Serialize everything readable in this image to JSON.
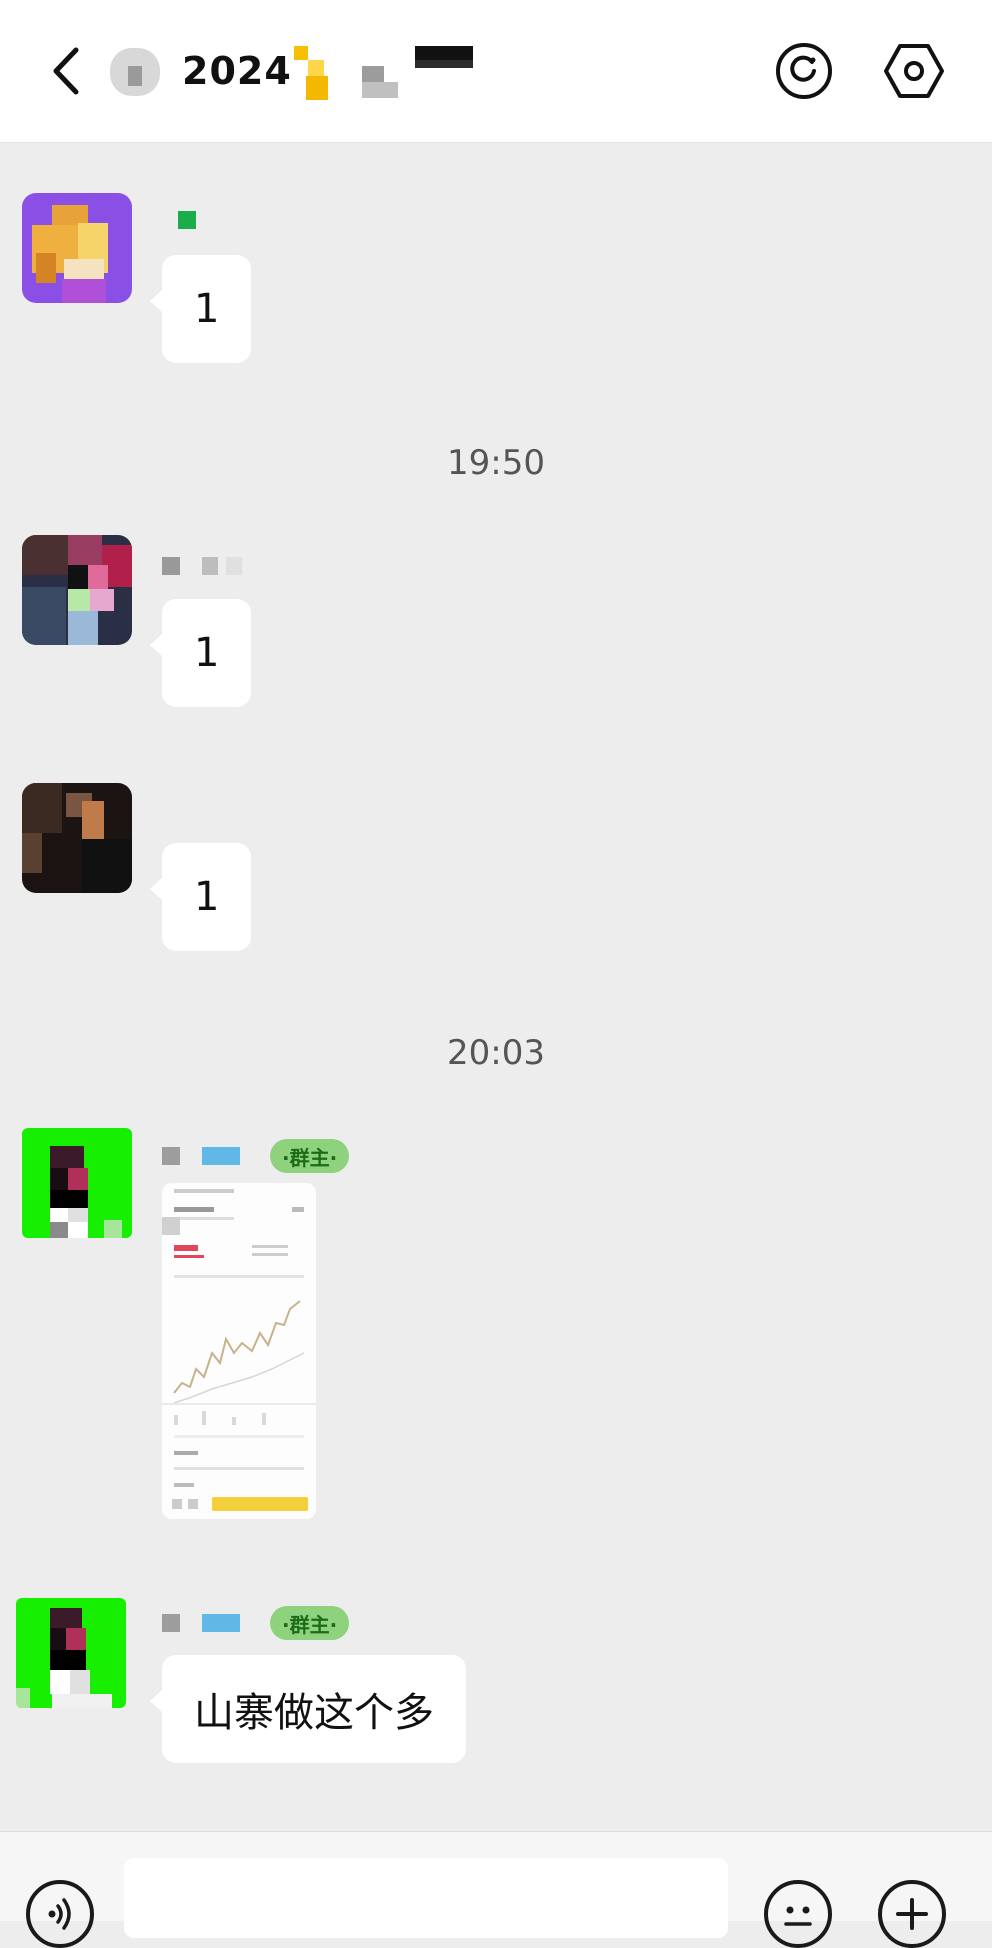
{
  "header": {
    "title": "2024",
    "back_icon": "chevron-left-icon",
    "chat_info_icon": "mini-program-icon",
    "settings_icon": "hexagon-settings-icon"
  },
  "messages": [
    {
      "type": "text",
      "text": "1"
    },
    {
      "type": "timestamp",
      "text": "19:50"
    },
    {
      "type": "text",
      "text": "1"
    },
    {
      "type": "text",
      "text": "1"
    },
    {
      "type": "timestamp",
      "text": "20:03"
    },
    {
      "type": "image",
      "role_badge": "·群主·",
      "thumbnail_icon": "trading-chart-screenshot"
    },
    {
      "type": "text",
      "role_badge": "·群主·",
      "text": "山寨做这个多"
    }
  ],
  "input_bar": {
    "voice_icon": "voice-icon",
    "input_value": "",
    "emoji_icon": "emoji-icon",
    "plus_icon": "plus-icon"
  },
  "colors": {
    "chat_bg": "#ededed",
    "bubble_bg": "#ffffff",
    "badge_bg": "#8ed27d",
    "badge_text": "#1c6b18"
  }
}
